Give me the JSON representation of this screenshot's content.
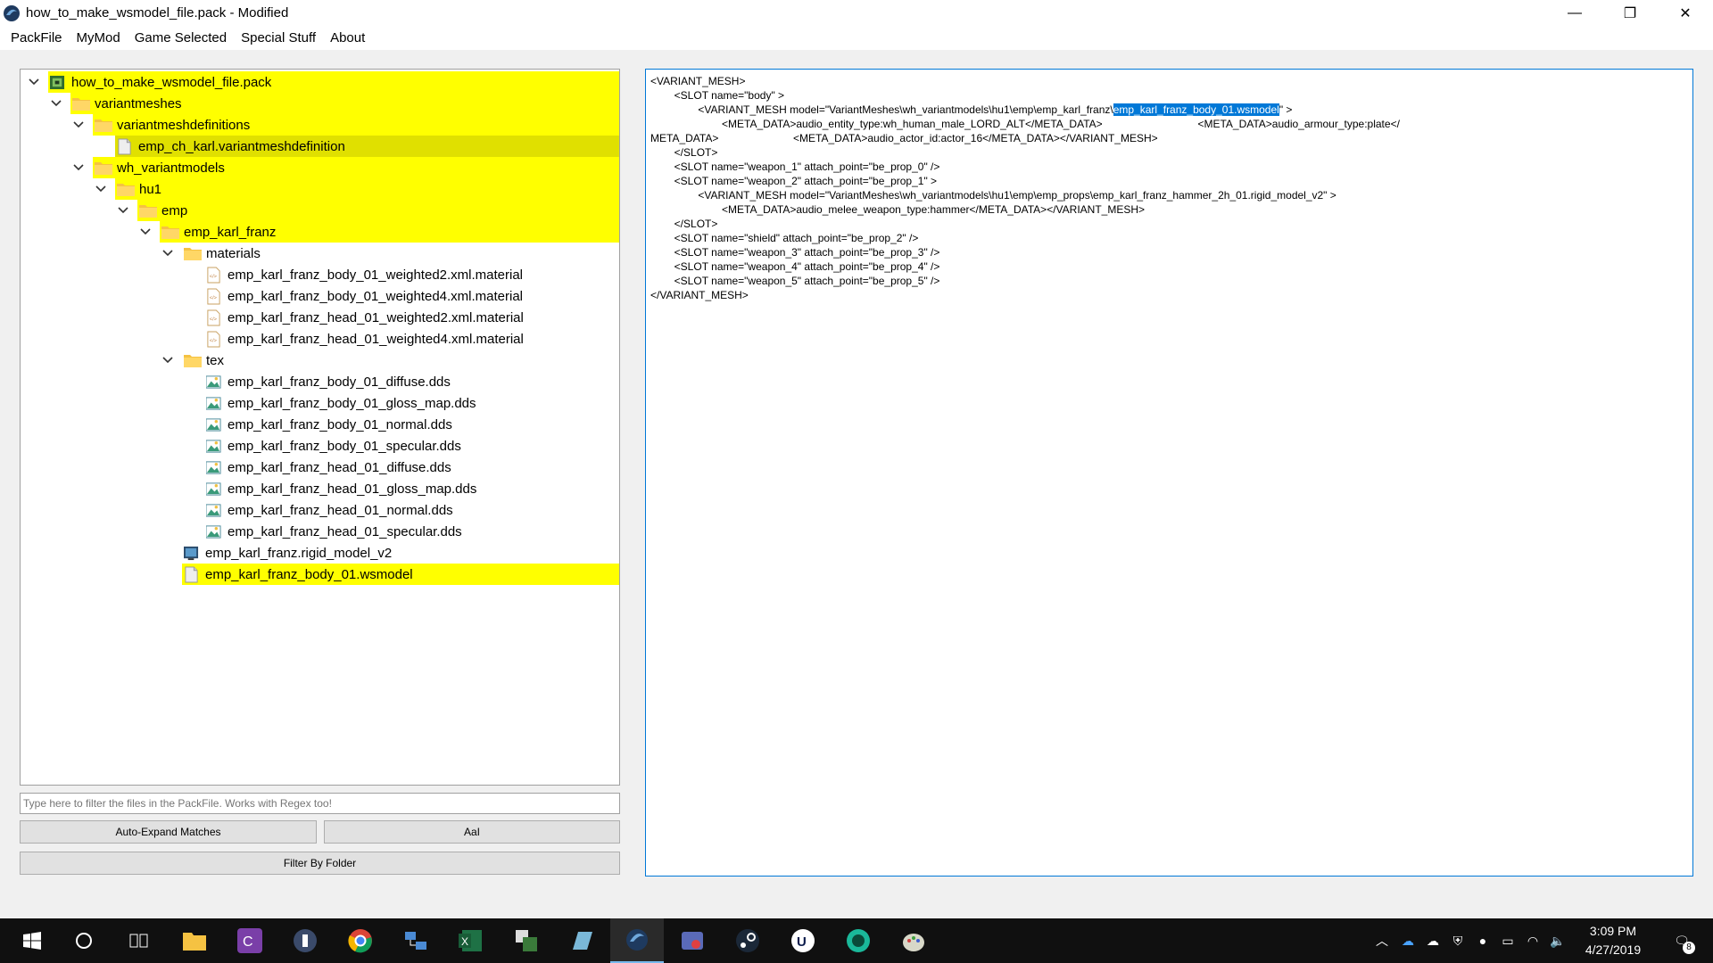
{
  "window": {
    "title": "how_to_make_wsmodel_file.pack - Modified",
    "minimize": "—",
    "restore": "❐",
    "close": "✕"
  },
  "menu": [
    "PackFile",
    "MyMod",
    "Game Selected",
    "Special Stuff",
    "About"
  ],
  "tree": [
    {
      "label": "how_to_make_wsmodel_file.pack",
      "icon": "pack-icon",
      "level": 0,
      "expanded": true,
      "highlight": true
    },
    {
      "label": "variantmeshes",
      "icon": "folder-icon",
      "level": 1,
      "expanded": true,
      "highlight": true
    },
    {
      "label": "variantmeshdefinitions",
      "icon": "folder-icon",
      "level": 2,
      "expanded": true,
      "highlight": true
    },
    {
      "label": "emp_ch_karl.variantmeshdefinition",
      "icon": "file-icon",
      "level": 3,
      "expanded": null,
      "highlight": true,
      "selected": true
    },
    {
      "label": "wh_variantmodels",
      "icon": "folder-icon",
      "level": 2,
      "expanded": true,
      "highlight": true
    },
    {
      "label": "hu1",
      "icon": "folder-icon",
      "level": 3,
      "expanded": true,
      "highlight": true
    },
    {
      "label": "emp",
      "icon": "folder-icon",
      "level": 4,
      "expanded": true,
      "highlight": true
    },
    {
      "label": "emp_karl_franz",
      "icon": "folder-icon",
      "level": 5,
      "expanded": true,
      "highlight": true
    },
    {
      "label": "materials",
      "icon": "folder-icon",
      "level": 6,
      "expanded": true,
      "highlight": false
    },
    {
      "label": "emp_karl_franz_body_01_weighted2.xml.material",
      "icon": "xml-icon",
      "level": 7,
      "expanded": null,
      "highlight": false
    },
    {
      "label": "emp_karl_franz_body_01_weighted4.xml.material",
      "icon": "xml-icon",
      "level": 7,
      "expanded": null,
      "highlight": false
    },
    {
      "label": "emp_karl_franz_head_01_weighted2.xml.material",
      "icon": "xml-icon",
      "level": 7,
      "expanded": null,
      "highlight": false
    },
    {
      "label": "emp_karl_franz_head_01_weighted4.xml.material",
      "icon": "xml-icon",
      "level": 7,
      "expanded": null,
      "highlight": false
    },
    {
      "label": "tex",
      "icon": "folder-icon",
      "level": 6,
      "expanded": true,
      "highlight": false
    },
    {
      "label": "emp_karl_franz_body_01_diffuse.dds",
      "icon": "image-icon",
      "level": 7,
      "expanded": null,
      "highlight": false
    },
    {
      "label": "emp_karl_franz_body_01_gloss_map.dds",
      "icon": "image-icon",
      "level": 7,
      "expanded": null,
      "highlight": false
    },
    {
      "label": "emp_karl_franz_body_01_normal.dds",
      "icon": "image-icon",
      "level": 7,
      "expanded": null,
      "highlight": false
    },
    {
      "label": "emp_karl_franz_body_01_specular.dds",
      "icon": "image-icon",
      "level": 7,
      "expanded": null,
      "highlight": false
    },
    {
      "label": "emp_karl_franz_head_01_diffuse.dds",
      "icon": "image-icon",
      "level": 7,
      "expanded": null,
      "highlight": false
    },
    {
      "label": "emp_karl_franz_head_01_gloss_map.dds",
      "icon": "image-icon",
      "level": 7,
      "expanded": null,
      "highlight": false
    },
    {
      "label": "emp_karl_franz_head_01_normal.dds",
      "icon": "image-icon",
      "level": 7,
      "expanded": null,
      "highlight": false
    },
    {
      "label": "emp_karl_franz_head_01_specular.dds",
      "icon": "image-icon",
      "level": 7,
      "expanded": null,
      "highlight": false
    },
    {
      "label": "emp_karl_franz.rigid_model_v2",
      "icon": "model-icon",
      "level": 6,
      "expanded": null,
      "highlight": false
    },
    {
      "label": "emp_karl_franz_body_01.wsmodel",
      "icon": "file-icon",
      "level": 6,
      "expanded": null,
      "highlight": true
    }
  ],
  "filter": {
    "placeholder": "Type here to filter the files in the PackFile. Works with Regex too!",
    "auto_expand": "Auto-Expand Matches",
    "case": "AaI",
    "by_folder": "Filter By Folder"
  },
  "editor": {
    "lines": [
      "<VARIANT_MESH>",
      "\t\t<SLOT name=\"body\" >",
      "\t\t\t\t<VARIANT_MESH model=\"VariantMeshes\\wh_variantmodels\\hu1\\emp\\emp_karl_franz\\",
      "\t\t\t\t\t\t<META_DATA>audio_entity_type:wh_human_male_LORD_ALT</META_DATA>\t\t\t\t\t\t\t\t<META_DATA>audio_armour_type:plate</",
      "META_DATA>\t\t\t\t\t\t\t<META_DATA>audio_actor_id:actor_16</META_DATA></VARIANT_MESH>",
      "\t\t</SLOT>",
      "\t\t<SLOT name=\"weapon_1\" attach_point=\"be_prop_0\" />",
      "\t\t<SLOT name=\"weapon_2\" attach_point=\"be_prop_1\" >",
      "\t\t\t\t<VARIANT_MESH model=\"VariantMeshes\\wh_variantmodels\\hu1\\emp\\emp_props\\emp_karl_franz_hammer_2h_01.rigid_model_v2\" >",
      "\t\t\t\t\t\t<META_DATA>audio_melee_weapon_type:hammer</META_DATA></VARIANT_MESH>",
      "\t\t</SLOT>",
      "\t\t<SLOT name=\"shield\" attach_point=\"be_prop_2\" />",
      "\t\t<SLOT name=\"weapon_3\" attach_point=\"be_prop_3\" />",
      "\t\t<SLOT name=\"weapon_4\" attach_point=\"be_prop_4\" />",
      "\t\t<SLOT name=\"weapon_5\" attach_point=\"be_prop_5\" />",
      "</VARIANT_MESH>"
    ],
    "selected_text": "emp_karl_franz_body_01.wsmodel",
    "after_selection": "\" >"
  },
  "taskbar": {
    "time": "3:09 PM",
    "date": "4/27/2019",
    "notification_count": "8"
  },
  "colors": {
    "highlight": "#ffff00",
    "selected": "#e0e000",
    "accent": "#0078d7",
    "taskbar": "#101010"
  }
}
